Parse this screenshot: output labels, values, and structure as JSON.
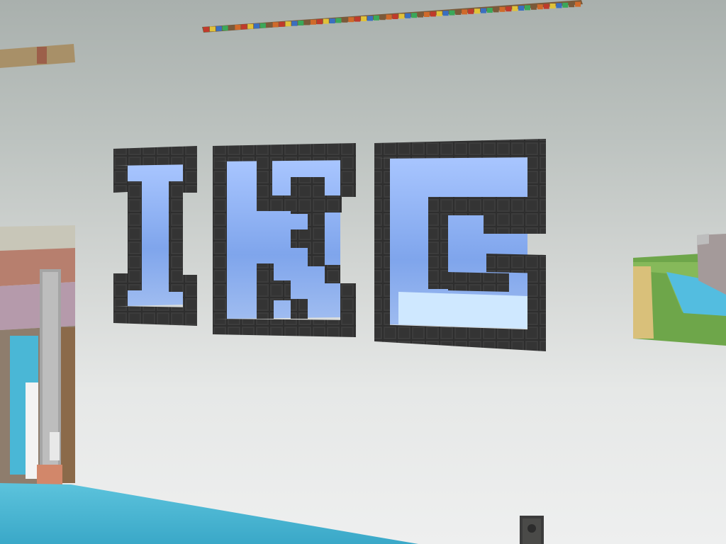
{
  "scene": {
    "description_sign_letters": [
      "I",
      "K",
      "G"
    ],
    "colors": {
      "sky_top": "#a9b0ad",
      "sky_bottom": "#eeefef",
      "frame_block": "#3a3a3a",
      "glass_fill": "#8fb2ef",
      "water": "#4fb9d6",
      "grass": "#6fa84a",
      "sand": "#d8c27c"
    },
    "icons": [
      "obsidian-block-icon",
      "glass-pane-icon",
      "wool-strip-icon"
    ]
  }
}
